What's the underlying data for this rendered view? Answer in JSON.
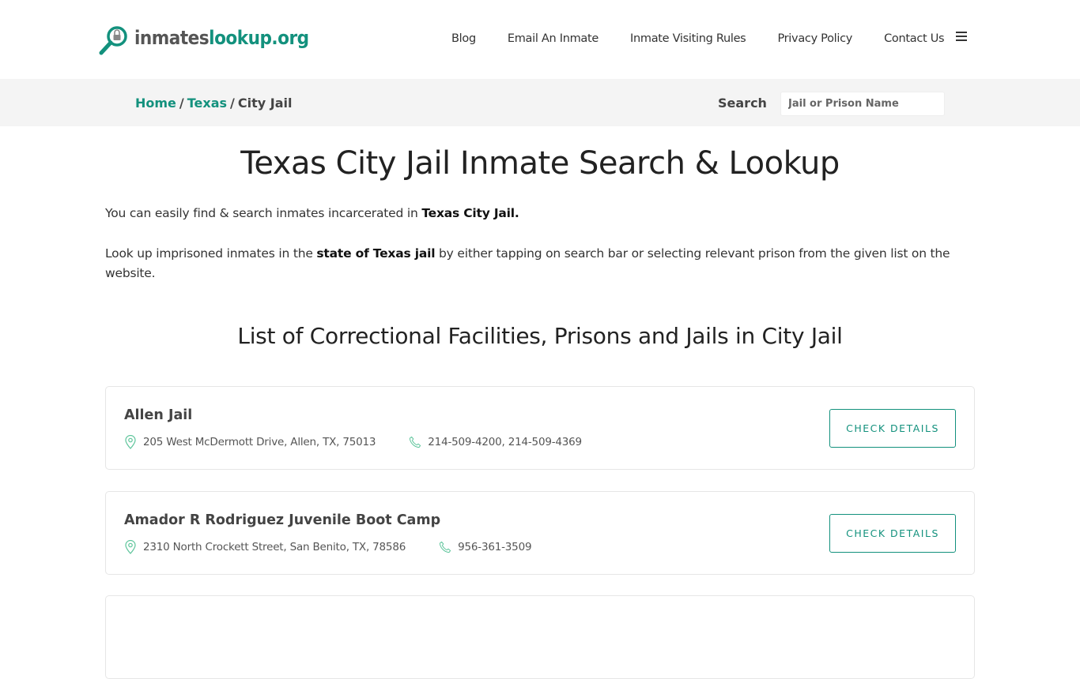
{
  "header": {
    "logo": {
      "part1": "inmates",
      "part2": "lookup.org"
    },
    "nav": [
      "Blog",
      "Email An Inmate",
      "Inmate Visiting Rules",
      "Privacy Policy",
      "Contact Us"
    ],
    "menu_icon": "hamburger-icon"
  },
  "breadcrumb": {
    "home": "Home",
    "state": "Texas",
    "current": "City Jail",
    "separator": "/"
  },
  "search": {
    "label": "Search",
    "placeholder": "Jail or Prison Name"
  },
  "page": {
    "title": "Texas City Jail Inmate Search & Lookup",
    "intro_pre": "You can easily find & search inmates incarcerated in ",
    "intro_bold": "Texas City Jail.",
    "desc_pre": "Look up imprisoned inmates in the ",
    "desc_bold": "state of Texas jail",
    "desc_post": " by either tapping on search bar or selecting relevant prison from the given list on the website.",
    "list_title": "List of Correctional Facilities, Prisons and Jails in City Jail"
  },
  "facilities": [
    {
      "name": "Allen Jail",
      "address": "205 West McDermott Drive, Allen, TX, 75013",
      "phone": "214-509-4200, 214-509-4369",
      "button": "CHECK DETAILS"
    },
    {
      "name": "Amador R Rodriguez Juvenile Boot Camp",
      "address": "2310 North Crockett Street, San Benito, TX, 78586",
      "phone": "956-361-3509",
      "button": "CHECK DETAILS"
    }
  ],
  "colors": {
    "brand": "#13917d",
    "text": "#333333",
    "crumb_bg": "#f4f4f4"
  }
}
